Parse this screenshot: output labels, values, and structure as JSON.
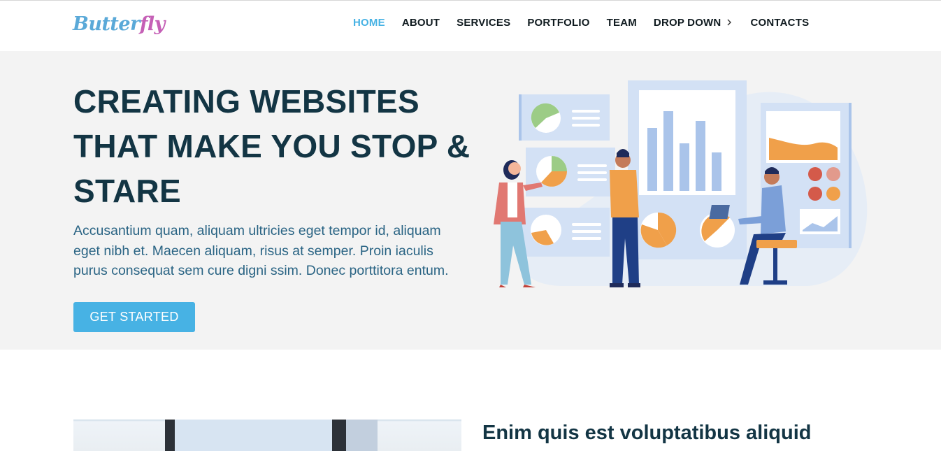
{
  "header": {
    "logo_part1": "Butter",
    "logo_part2": "fly",
    "nav": [
      {
        "label": "HOME",
        "active": true
      },
      {
        "label": "ABOUT"
      },
      {
        "label": "SERVICES"
      },
      {
        "label": "PORTFOLIO"
      },
      {
        "label": "TEAM"
      },
      {
        "label": "DROP DOWN",
        "icon": "chevron-right-icon"
      },
      {
        "label": "CONTACTS"
      }
    ]
  },
  "hero": {
    "title": "CREATING WEBSITES THAT MAKE YOU STOP & STARE",
    "description": "Accusantium quam, aliquam ultricies eget tempor id, aliquam eget nibh et. Maecen aliquam, risus at semper. Proin iaculis purus consequat sem cure digni ssim. Donec porttitora entum.",
    "cta_label": "GET STARTED",
    "illustration": "analytics-dashboard-illustration"
  },
  "about": {
    "title": "Enim quis est voluptatibus aliquid",
    "image": "office-photo"
  },
  "colors": {
    "accent": "#47b2e4",
    "heading": "#133544",
    "text": "#2a6484",
    "hero_bg": "#f3f3f3",
    "nav_text": "#0f1a1f"
  }
}
